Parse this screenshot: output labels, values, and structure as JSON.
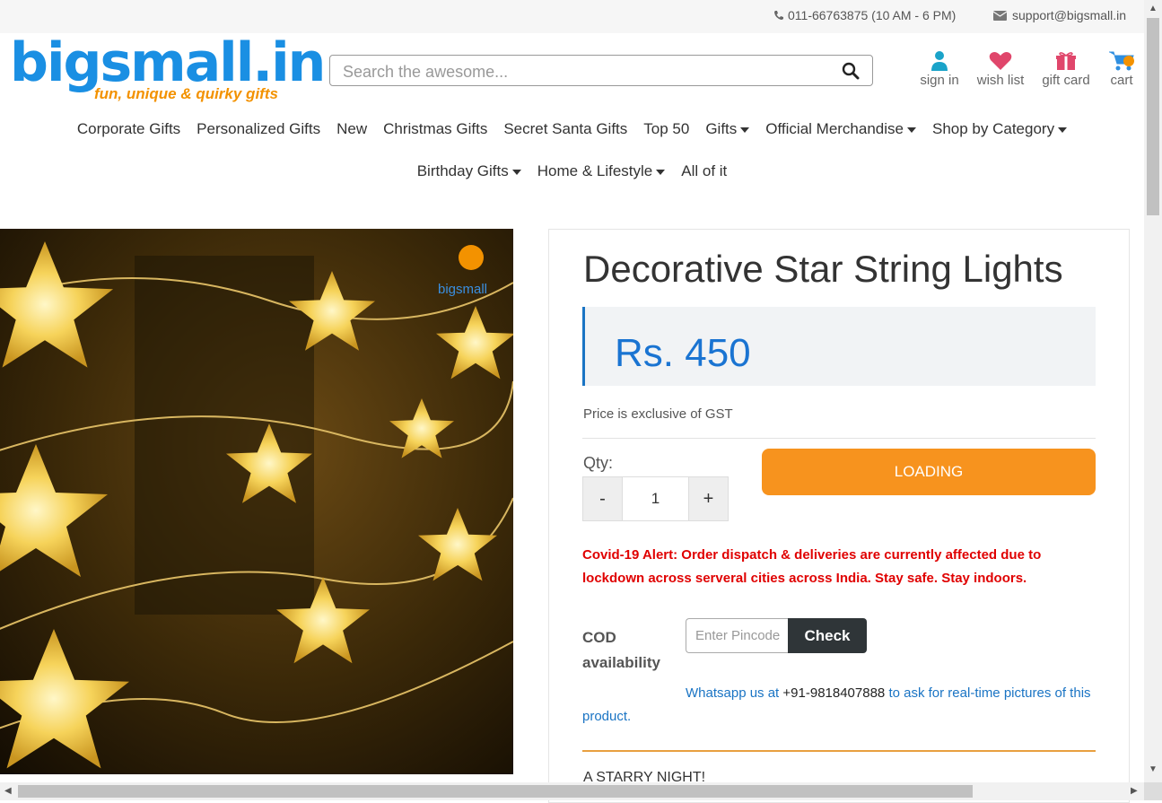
{
  "topbar": {
    "phone": "011-66763875 (10 AM - 6 PM)",
    "email": "support@bigsmall.in"
  },
  "logo": {
    "text": "bigsmall.in",
    "tagline": "fun, unique & quirky gifts"
  },
  "search": {
    "placeholder": "Search the awesome..."
  },
  "user_links": [
    {
      "label": "sign in",
      "icon": "user-icon"
    },
    {
      "label": "wish list",
      "icon": "heart-icon"
    },
    {
      "label": "gift card",
      "icon": "gift-icon"
    },
    {
      "label": "cart",
      "icon": "cart-icon"
    }
  ],
  "nav_row1": [
    "Corporate Gifts",
    "Personalized Gifts",
    "New",
    "Christmas Gifts",
    "Secret Santa Gifts",
    "Top 50",
    "Gifts",
    "Official Merchandise",
    "Shop by Category"
  ],
  "nav_row2": [
    "Birthday Gifts",
    "Home & Lifestyle",
    "All of it"
  ],
  "product": {
    "title": "Decorative Star String Lights",
    "price": "Rs. 450",
    "gst_note": "Price is exclusive of GST",
    "qty_label": "Qty:",
    "qty_minus": "-",
    "qty_value": "1",
    "qty_plus": "+",
    "cart_button": "LOADING",
    "covid_alert": "Covid-19 Alert: Order dispatch & deliveries are currently affected due to lockdown across serveral cities across India. Stay safe. Stay indoors.",
    "cod_label": "COD availability",
    "pincode_placeholder": "Enter Pincode",
    "check_button": "Check",
    "whatsapp_prefix": "Whatsapp us at ",
    "whatsapp_number": "+91-9818407888",
    "whatsapp_suffix": " to ask for real-time pictures of this product.",
    "section_heading": "A STARRY NIGHT!"
  },
  "image_watermark": "bigsmall",
  "colors": {
    "brand_blue": "#1a8fe3",
    "brand_orange": "#f39200",
    "price_blue": "#1a74d2",
    "alert_red": "#e00000",
    "button_orange": "#f7931e",
    "wishlist_pink": "#e0466b",
    "signin_teal": "#1aa3c9"
  }
}
